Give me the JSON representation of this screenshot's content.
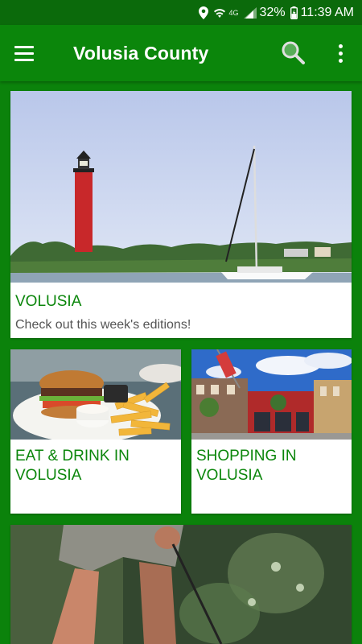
{
  "status_bar": {
    "network": "4G",
    "battery": "32%",
    "time": "11:39 AM"
  },
  "app_bar": {
    "title": "Volusia County",
    "icons": [
      "menu-icon",
      "search-icon",
      "more-vert-icon"
    ]
  },
  "cards": [
    {
      "title": "VOLUSIA",
      "subtitle": "Check out this week's editions!",
      "image": "lighthouse-sailboat-photo"
    },
    {
      "title": "EAT & DRINK IN VOLUSIA",
      "image": "burger-fries-photo"
    },
    {
      "title": "SHOPPING IN VOLUSIA",
      "image": "storefront-street-photo"
    },
    {
      "title": "",
      "image": "golfer-photo"
    }
  ],
  "colors": {
    "status_bar": "#0b6a0b",
    "app_bar": "#0b860b",
    "background": "#0b820b",
    "card_title": "#0b860b"
  }
}
